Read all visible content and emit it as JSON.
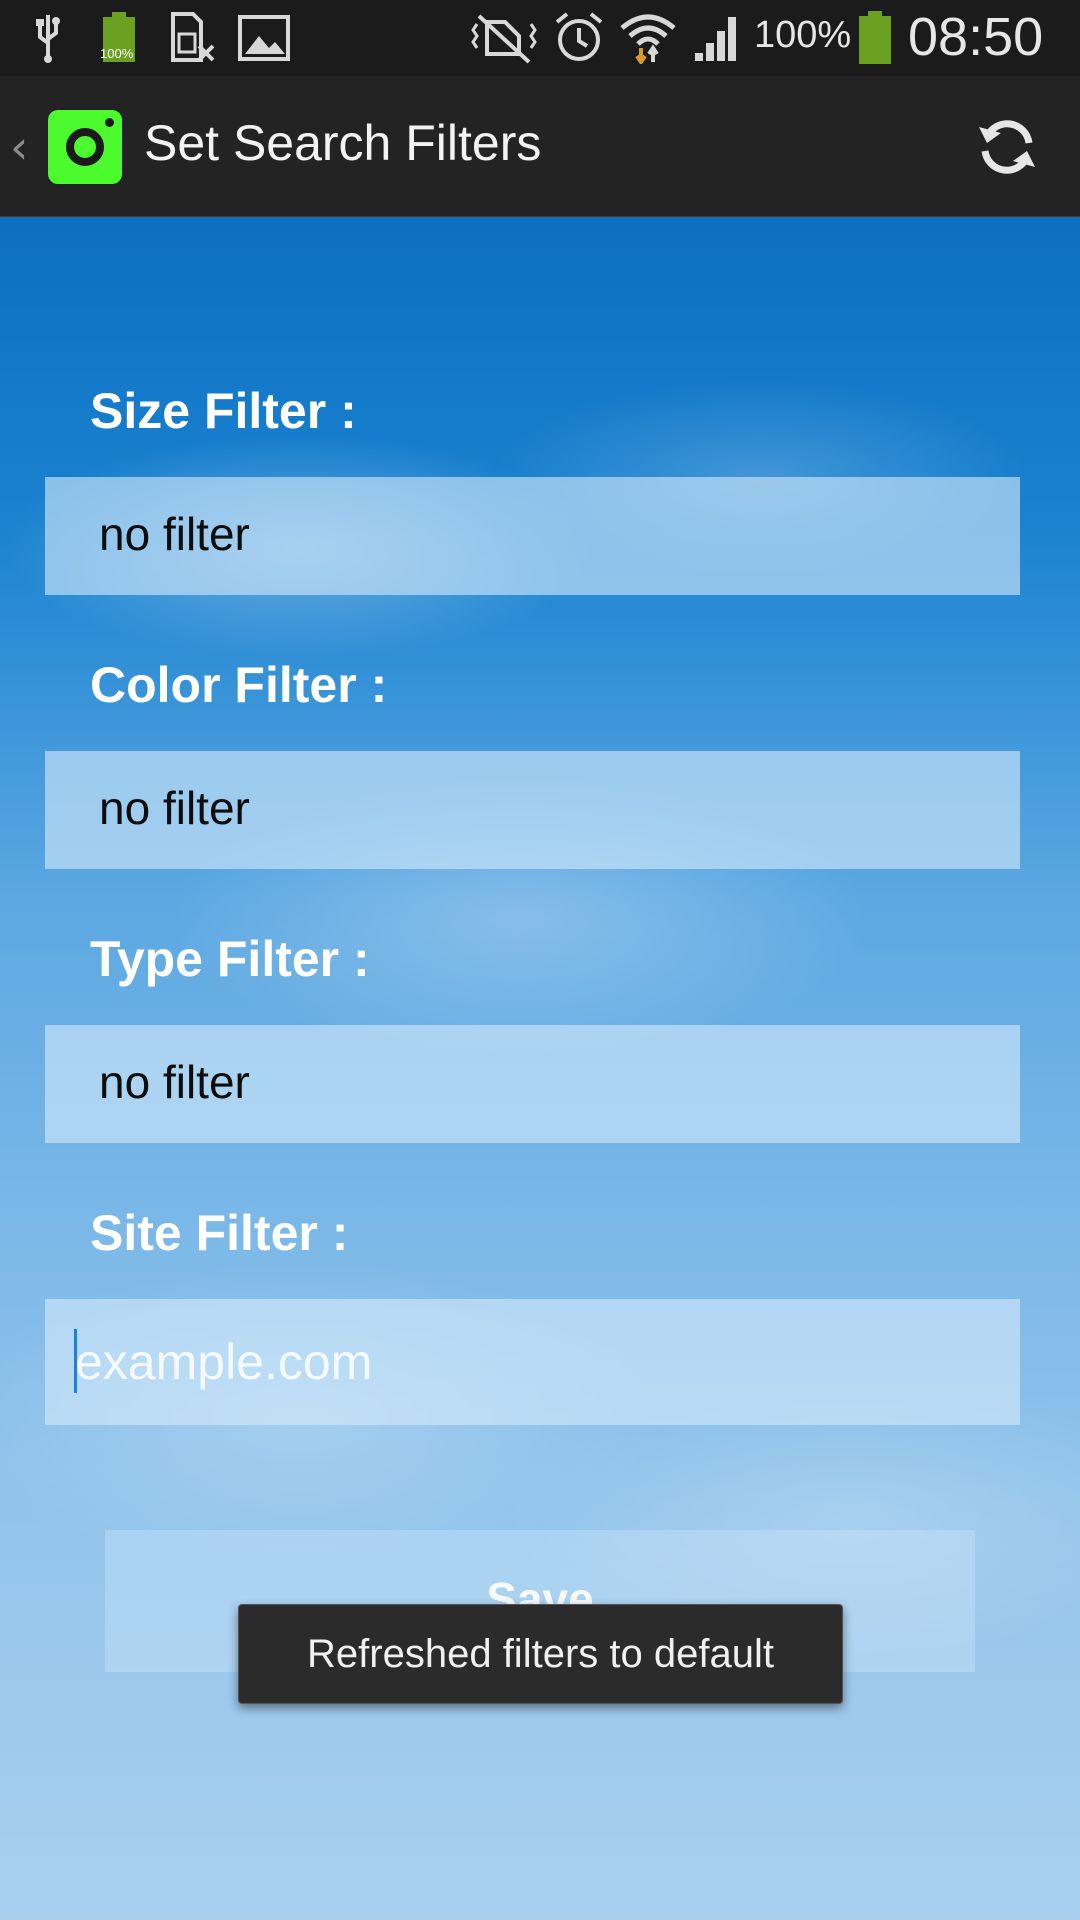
{
  "status_bar": {
    "icons": [
      "usb-icon",
      "battery-full-icon",
      "sim-off-icon",
      "gallery-icon",
      "mute-vibrate-icon",
      "alarm-icon",
      "wifi-icon",
      "signal-icon",
      "battery-icon"
    ],
    "battery_small_label": "100%",
    "battery_percent": "100%",
    "time": "08:50"
  },
  "action_bar": {
    "title": "Set Search Filters",
    "back_icon": "chevron-left-icon",
    "app_icon": "camera-app-icon",
    "refresh_icon": "refresh-icon"
  },
  "filters": {
    "size": {
      "label": "Size Filter :",
      "value": "no filter"
    },
    "color": {
      "label": "Color Filter :",
      "value": "no filter"
    },
    "type": {
      "label": "Type Filter :",
      "value": "no filter"
    },
    "site": {
      "label": "Site Filter :",
      "value": "",
      "placeholder": "example.com"
    }
  },
  "save_button": {
    "label": "Save"
  },
  "toast": {
    "message": "Refreshed filters to default"
  },
  "colors": {
    "status_bar_bg": "#1b1b1b",
    "action_bar_bg": "#232323",
    "app_icon_green": "#4cfb2d",
    "battery_green": "#6aa120",
    "caret_blue": "#1e7fe0",
    "toast_bg": "#2b2b2b"
  }
}
